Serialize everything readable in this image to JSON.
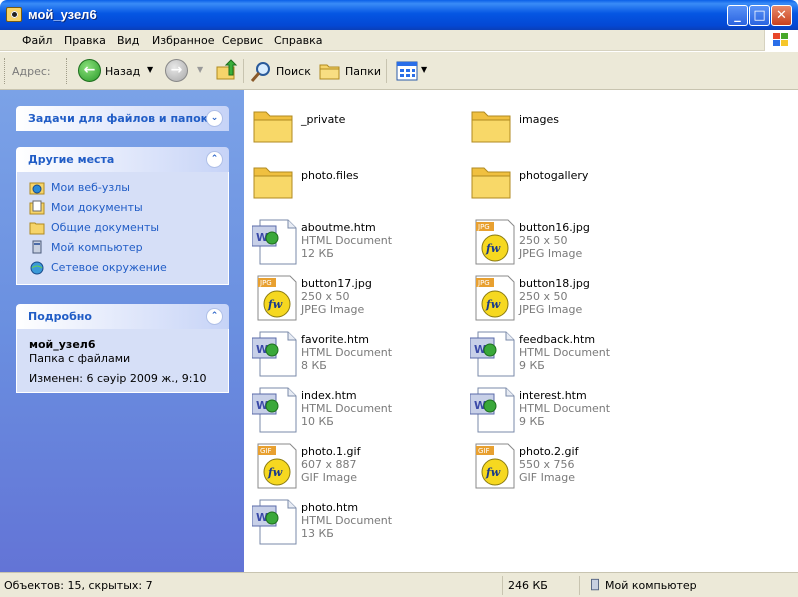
{
  "window": {
    "title": "мой_узел6"
  },
  "menu": [
    "Файл",
    "Правка",
    "Вид",
    "Избранное",
    "Сервис",
    "Справка"
  ],
  "toolbar": {
    "address_label": "Адрес:",
    "back_label": "Назад",
    "search_label": "Поиск",
    "folders_label": "Папки"
  },
  "tasks_panel": {
    "title": "Задачи для файлов и папок"
  },
  "places_panel": {
    "title": "Другие места",
    "links": [
      "Мои веб-узлы",
      "Мои документы",
      "Общие документы",
      "Мой компьютер",
      "Сетевое окружение"
    ]
  },
  "details_panel": {
    "title": "Подробно",
    "name": "мой_узел6",
    "type": "Папка с файлами",
    "modified": "Изменен: 6 сәуір 2009 ж., 9:10"
  },
  "files": [
    {
      "name": "_private",
      "kind": "folder",
      "line2": "",
      "line3": ""
    },
    {
      "name": "images",
      "kind": "folder",
      "line2": "",
      "line3": ""
    },
    {
      "name": "photo.files",
      "kind": "folder",
      "line2": "",
      "line3": ""
    },
    {
      "name": "photogallery",
      "kind": "folder",
      "line2": "",
      "line3": ""
    },
    {
      "name": "aboutme.htm",
      "kind": "html",
      "line2": "HTML Document",
      "line3": "12 КБ"
    },
    {
      "name": "button16.jpg",
      "kind": "jpg",
      "line2": "250 x 50",
      "line3": "JPEG Image"
    },
    {
      "name": "button17.jpg",
      "kind": "jpg",
      "line2": "250 x 50",
      "line3": "JPEG Image"
    },
    {
      "name": "button18.jpg",
      "kind": "jpg",
      "line2": "250 x 50",
      "line3": "JPEG Image"
    },
    {
      "name": "favorite.htm",
      "kind": "html",
      "line2": "HTML Document",
      "line3": "8 КБ"
    },
    {
      "name": "feedback.htm",
      "kind": "html",
      "line2": "HTML Document",
      "line3": "9 КБ"
    },
    {
      "name": "index.htm",
      "kind": "html",
      "line2": "HTML Document",
      "line3": "10 КБ"
    },
    {
      "name": "interest.htm",
      "kind": "html",
      "line2": "HTML Document",
      "line3": "9 КБ"
    },
    {
      "name": "photo.1.gif",
      "kind": "gif",
      "line2": "607 x 887",
      "line3": "GIF Image"
    },
    {
      "name": "photo.2.gif",
      "kind": "gif",
      "line2": "550 x 756",
      "line3": "GIF Image"
    },
    {
      "name": "photo.htm",
      "kind": "html",
      "line2": "HTML Document",
      "line3": "13 КБ"
    }
  ],
  "statusbar": {
    "objects": "Объектов: 15, скрытых: 7",
    "size": "246 КБ",
    "location": "Мой компьютер"
  },
  "colors": {
    "title_blue": "#0556e3",
    "link_blue": "#215dc6",
    "pane_blue": "#6a8fe0"
  }
}
